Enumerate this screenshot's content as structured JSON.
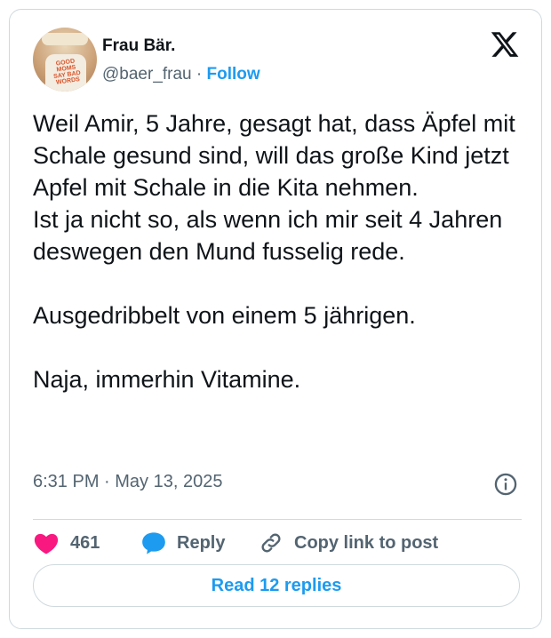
{
  "author": {
    "display_name": "Frau Bär.",
    "handle": "@baer_frau",
    "separator": "·",
    "follow_label": "Follow",
    "avatar_shirt_text": "GOOD MOMS SAY BAD WORDS"
  },
  "tweet": {
    "text": "Weil Amir, 5 Jahre, gesagt hat, dass Äpfel mit Schale gesund sind, will das große Kind jetzt Apfel mit Schale in die Kita nehmen.\nIst ja nicht so, als wenn ich mir seit 4 Jahren deswegen den Mund fusselig rede.\n\nAusgedribbelt von einem 5 jährigen.\n\nNaja, immerhin Vitamine.",
    "timestamp": "6:31 PM · May 13, 2025"
  },
  "actions": {
    "like_count": "461",
    "reply_label": "Reply",
    "copy_label": "Copy link to post"
  },
  "read_replies_label": "Read 12 replies",
  "colors": {
    "accent": "#1d9bf0",
    "like": "#f91880",
    "text": "#0f1419",
    "muted": "#536471",
    "border": "#cfd9de"
  },
  "icons": [
    "x-logo-icon",
    "info-icon",
    "heart-icon",
    "reply-bubble-icon",
    "link-icon"
  ]
}
